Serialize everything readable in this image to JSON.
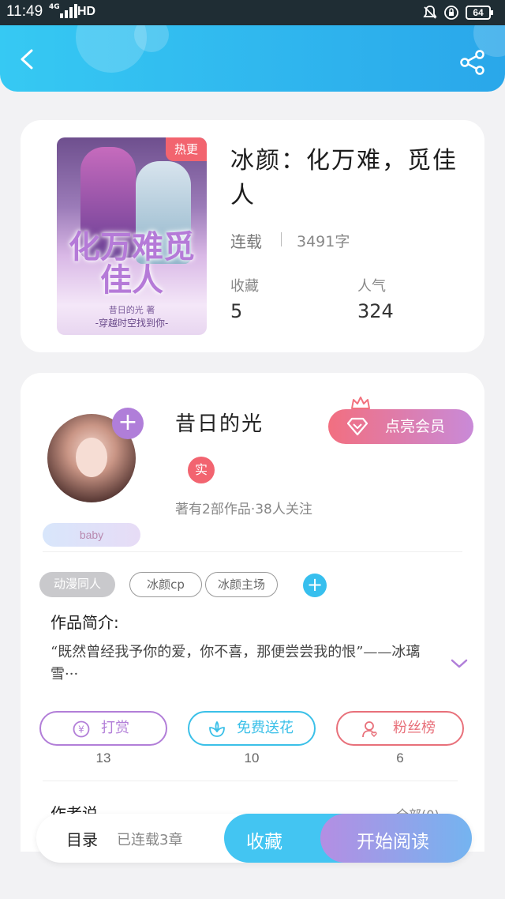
{
  "status_bar": {
    "time": "11:49",
    "network": "4G",
    "hd": "HD",
    "battery": "64"
  },
  "header": {
    "back_icon": "back-arrow-icon",
    "share_icon": "share-icon",
    "accent": "#36c9f3"
  },
  "book": {
    "hot_badge": "热更",
    "title": "冰颜：化万难，觅佳人",
    "status": "连载",
    "word_count": "3491字",
    "cover": {
      "title": "化万难觅佳人",
      "author_credit": "昔日的光 著",
      "tagline": "-穿越时空找到你-"
    },
    "stats": [
      {
        "label": "收藏",
        "value": "5"
      },
      {
        "label": "人气",
        "value": "324"
      }
    ]
  },
  "author": {
    "name": "昔日的光",
    "verified_label": "实",
    "meta": "著有2部作品·38人关注",
    "badge": "baby",
    "vip_button": "点亮会员"
  },
  "tags": [
    {
      "label": "动漫同人",
      "style": "fill"
    },
    {
      "label": "冰颜cp",
      "style": "outline"
    },
    {
      "label": "冰颜主场",
      "style": "outline"
    }
  ],
  "intro": {
    "title": "作品简介:",
    "text": "“既然曾经我予你的爱，你不喜，那便尝尝我的恨”——冰璃雪···"
  },
  "actions": [
    {
      "label": "打赏",
      "count": "13",
      "icon": "yen-coin-icon",
      "color": "#b27ed8"
    },
    {
      "label": "免费送花",
      "count": "10",
      "icon": "flower-icon",
      "color": "#3bc0e8"
    },
    {
      "label": "粉丝榜",
      "count": "6",
      "icon": "fan-user-icon",
      "color": "#e8707a"
    }
  ],
  "author_says": {
    "title": "作者说",
    "all_link": "全部(0)"
  },
  "bottom_bar": {
    "toc": "目录",
    "toc_count": "已连载3章",
    "favorite": "收藏",
    "start_reading": "开始阅读"
  }
}
